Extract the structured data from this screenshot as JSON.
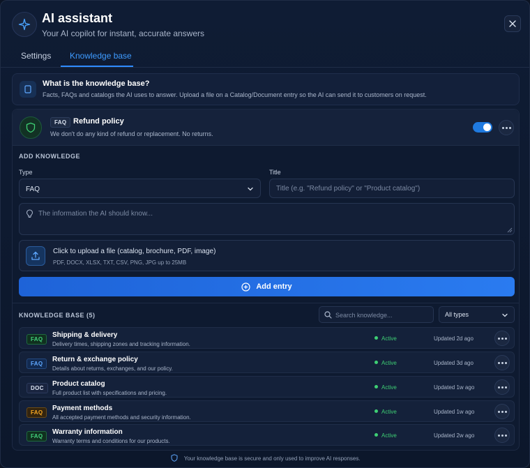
{
  "header": {
    "title": "AI assistant",
    "subtitle": "Your AI copilot for instant, accurate answers",
    "icon": "sparkle-icon"
  },
  "tabs": [
    {
      "label": "Settings",
      "active": false
    },
    {
      "label": "Knowledge base",
      "active": true
    }
  ],
  "info": {
    "title": "What is the knowledge base?",
    "text": "Facts, FAQs and catalogs the AI uses to answer. Upload a file on a Catalog/Document entry so the AI can send it to customers on request."
  },
  "expanded_entry": {
    "badge": "FAQ",
    "title": "Refund policy",
    "description": "We don't do any kind of refund or replacement. No returns.",
    "enabled": true
  },
  "form": {
    "section_label": "ADD KNOWLEDGE",
    "type_label": "Type",
    "type_value": "FAQ",
    "title_label": "Title",
    "title_placeholder": "Title (e.g. \"Refund policy\" or \"Product catalog\")",
    "info_placeholder": "The information the AI should know...",
    "upload_title": "Click to upload a file (catalog, brochure, PDF, image)",
    "upload_sub": "PDF, DOCX, XLSX, TXT, CSV, PNG, JPG up to 25MB",
    "add_button": "Add entry"
  },
  "knowledge_base": {
    "label": "KNOWLEDGE BASE (5)",
    "search_placeholder": "Search knowledge...",
    "filter_value": "All types",
    "entries": [
      {
        "badge": "FAQ",
        "badge_style": "faq-green",
        "title": "Shipping & delivery",
        "description": "Delivery times, shipping zones and tracking information.",
        "status": "Active",
        "updated": "Updated 2d ago"
      },
      {
        "badge": "FAQ",
        "badge_style": "faq-blue",
        "title": "Return & exchange policy",
        "description": "Details about returns, exchanges, and our policy.",
        "status": "Active",
        "updated": "Updated 3d ago"
      },
      {
        "badge": "DOC",
        "badge_style": "doc",
        "title": "Product catalog",
        "description": "Full product list with specifications and pricing.",
        "status": "Active",
        "updated": "Updated 1w ago"
      },
      {
        "badge": "FAQ",
        "badge_style": "faq-orange",
        "title": "Payment methods",
        "description": "All accepted payment methods and security information.",
        "status": "Active",
        "updated": "Updated 1w ago"
      },
      {
        "badge": "FAQ",
        "badge_style": "faq-green",
        "title": "Warranty information",
        "description": "Warranty terms and conditions for our products.",
        "status": "Active",
        "updated": "Updated 2w ago"
      }
    ]
  },
  "footer": {
    "text": "Your knowledge base is secure and only used to improve AI responses."
  },
  "colors": {
    "accent": "#2f8cff",
    "active_green": "#3ecf74",
    "background": "#0c172b"
  }
}
